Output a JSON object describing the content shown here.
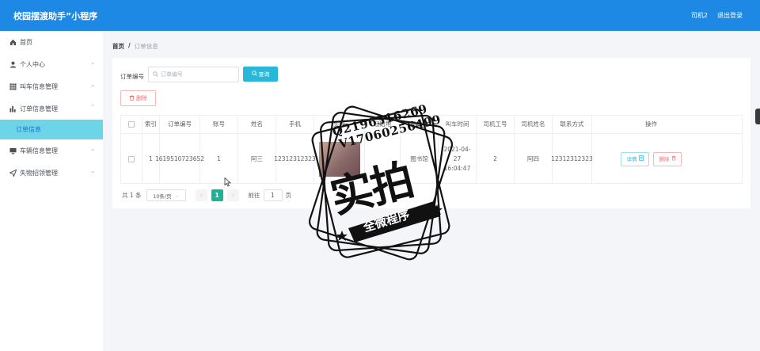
{
  "header": {
    "title": "校园摆渡助手”小程序",
    "user": "司机2",
    "logout": "退出登录"
  },
  "sidebar": {
    "items": [
      {
        "label": "首页",
        "icon": "home-icon"
      },
      {
        "label": "个人中心",
        "icon": "user-icon",
        "chevron": "down"
      },
      {
        "label": "叫车信息管理",
        "icon": "grid-icon",
        "chevron": "down"
      },
      {
        "label": "订单信息管理",
        "icon": "chart-icon",
        "chevron": "up"
      },
      {
        "label": "订单信息",
        "sub": true,
        "active": true
      },
      {
        "label": "车辆信息管理",
        "icon": "monitor-icon",
        "chevron": "down"
      },
      {
        "label": "失物招领管理",
        "icon": "send-icon",
        "chevron": "down"
      }
    ]
  },
  "breadcrumb": {
    "home": "首页",
    "separator": "/",
    "current": "订单信息"
  },
  "search": {
    "label": "订单编号",
    "placeholder": "订单编号",
    "button": "查询"
  },
  "toolbar": {
    "delete": "删除"
  },
  "table": {
    "columns": [
      "索引",
      "订单编号",
      "账号",
      "姓名",
      "手机",
      "头像",
      "起始地",
      "目的地",
      "叫车时间",
      "司机工号",
      "司机姓名",
      "联系方式",
      "操作"
    ],
    "rows": [
      {
        "index": "1",
        "order_no": "1619510723652",
        "account": "1",
        "name": "阿三",
        "phone": "12312312323",
        "origin": "",
        "destination": "图书馆",
        "time": "2021-04-27 16:04:47",
        "driver_no": "2",
        "driver_name": "阿四",
        "contact": "12312312323",
        "detail": "详情",
        "delete": "删除"
      }
    ]
  },
  "pager": {
    "total": "共 1 条",
    "page_size": "10条/页",
    "current": "1",
    "goto_prefix": "前往",
    "goto_value": "1",
    "goto_suffix": "页"
  },
  "watermark": {
    "line1": "Q2196316269",
    "line2": "V17060256499",
    "big": "实拍",
    "banner": "全微程序"
  },
  "colors": {
    "header": "#1e88e5",
    "active_sub": "#6cd5e8",
    "primary": "#27b8d8",
    "danger": "#f56c6c",
    "pager_active": "#1ab394"
  }
}
